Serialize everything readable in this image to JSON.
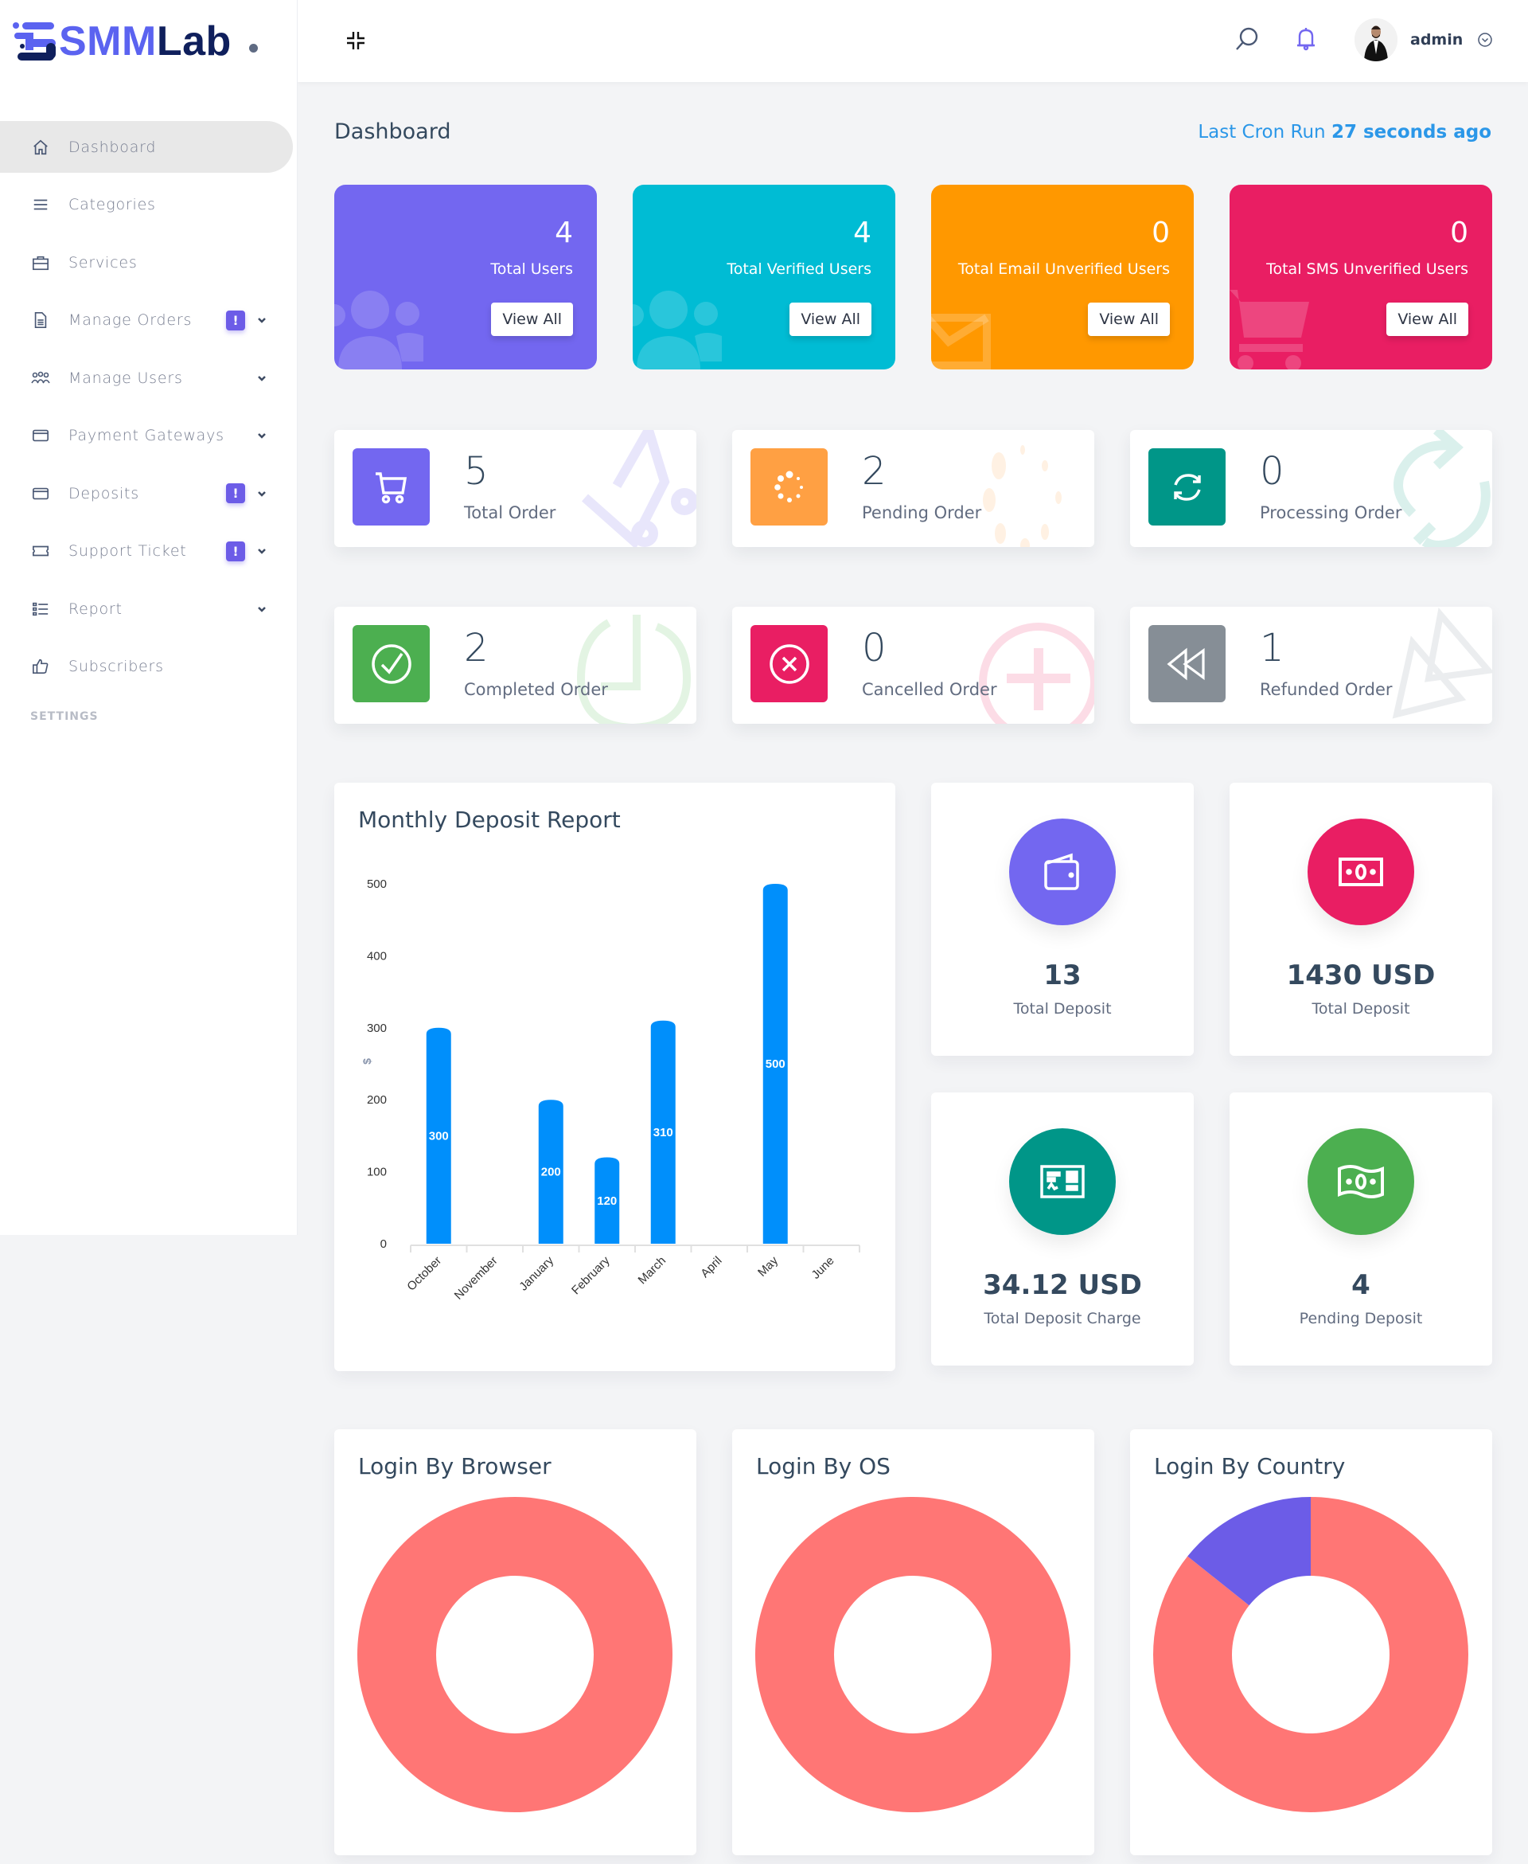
{
  "brand": {
    "name_part1": "SMM",
    "name_part2": "Lab"
  },
  "header": {
    "user_name": "admin",
    "icons": {
      "collapse": "collapse-icon",
      "search": "search-icon",
      "notifications": "bell-icon",
      "user_menu": "chevron-down-circle-icon"
    }
  },
  "sidebar": {
    "items": [
      {
        "label": "Dashboard",
        "icon": "home-icon",
        "active": true,
        "badge": null,
        "caret": false
      },
      {
        "label": "Categories",
        "icon": "menu-lines-icon",
        "active": false,
        "badge": null,
        "caret": false
      },
      {
        "label": "Services",
        "icon": "briefcase-icon",
        "active": false,
        "badge": null,
        "caret": false
      },
      {
        "label": "Manage Orders",
        "icon": "document-icon",
        "active": false,
        "badge": "!",
        "caret": true
      },
      {
        "label": "Manage Users",
        "icon": "users-group-icon",
        "active": false,
        "badge": null,
        "caret": true
      },
      {
        "label": "Payment Gateways",
        "icon": "credit-card-icon",
        "active": false,
        "badge": null,
        "caret": true
      },
      {
        "label": "Deposits",
        "icon": "credit-card-icon",
        "active": false,
        "badge": "!",
        "caret": true
      },
      {
        "label": "Support Ticket",
        "icon": "ticket-icon",
        "active": false,
        "badge": "!",
        "caret": true
      },
      {
        "label": "Report",
        "icon": "list-icon",
        "active": false,
        "badge": null,
        "caret": true
      },
      {
        "label": "Subscribers",
        "icon": "thumbs-up-icon",
        "active": false,
        "badge": null,
        "caret": false
      }
    ],
    "section_label": "SETTINGS"
  },
  "page": {
    "title": "Dashboard",
    "cron_prefix": "Last Cron Run",
    "cron_value": "27 seconds ago"
  },
  "user_stats": [
    {
      "value": "4",
      "label": "Total Users",
      "button": "View All",
      "color": "#7367f0",
      "bg_icon": "users-icon"
    },
    {
      "value": "4",
      "label": "Total Verified Users",
      "button": "View All",
      "color": "#00bcd4",
      "bg_icon": "users-icon"
    },
    {
      "value": "0",
      "label": "Total Email Unverified Users",
      "button": "View All",
      "color": "#ff9800",
      "bg_icon": "envelope-icon"
    },
    {
      "value": "0",
      "label": "Total SMS Unverified Users",
      "button": "View All",
      "color": "#e91e63",
      "bg_icon": "cart-icon"
    }
  ],
  "order_stats": [
    {
      "value": "5",
      "label": "Total Order",
      "color": "#7367f0",
      "icon": "cart-icon"
    },
    {
      "value": "2",
      "label": "Pending Order",
      "color": "#ffa043",
      "icon": "spinner-icon"
    },
    {
      "value": "0",
      "label": "Processing Order",
      "color": "#009688",
      "icon": "sync-icon"
    },
    {
      "value": "2",
      "label": "Completed Order",
      "color": "#4caf50",
      "icon": "check-circle-icon"
    },
    {
      "value": "0",
      "label": "Cancelled Order",
      "color": "#e91e63",
      "icon": "x-circle-icon"
    },
    {
      "value": "1",
      "label": "Refunded Order",
      "color": "#868e96",
      "icon": "rewind-icon"
    }
  ],
  "deposit_stats": [
    {
      "value": "13",
      "label": "Total Deposit",
      "color": "#7367f0",
      "icon": "wallet-icon"
    },
    {
      "value": "1430 USD",
      "label": "Total Deposit",
      "color": "#e91e63",
      "icon": "money-bill-icon"
    },
    {
      "value": "34.12 USD",
      "label": "Total Deposit Charge",
      "color": "#009688",
      "icon": "receipt-icon"
    },
    {
      "value": "4",
      "label": "Pending Deposit",
      "color": "#4caf50",
      "icon": "money-wave-icon"
    }
  ],
  "chart_data": [
    {
      "type": "bar",
      "title": "Monthly Deposit Report",
      "xlabel": "",
      "ylabel": "$",
      "categories": [
        "October",
        "November",
        "January",
        "February",
        "March",
        "April",
        "May",
        "June"
      ],
      "values": [
        300,
        0,
        200,
        120,
        310,
        0,
        500,
        0
      ],
      "data_labels": [
        "300",
        "",
        "200",
        "120",
        "310",
        "",
        "500",
        ""
      ],
      "ylim": [
        0,
        500
      ],
      "yticks": [
        0,
        100,
        200,
        300,
        400,
        500
      ],
      "grid": false,
      "color": "#008ffb"
    },
    {
      "type": "pie",
      "title": "Login By Browser",
      "donut": true,
      "slices": [
        {
          "value": 100,
          "color": "#ff7675"
        }
      ]
    },
    {
      "type": "pie",
      "title": "Login By OS",
      "donut": true,
      "slices": [
        {
          "value": 100,
          "color": "#ff7675"
        }
      ]
    },
    {
      "type": "pie",
      "title": "Login By Country",
      "donut": true,
      "slices": [
        {
          "value": 6,
          "color": "#ff7675"
        },
        {
          "value": 1,
          "color": "#6c5ce7"
        }
      ]
    }
  ]
}
